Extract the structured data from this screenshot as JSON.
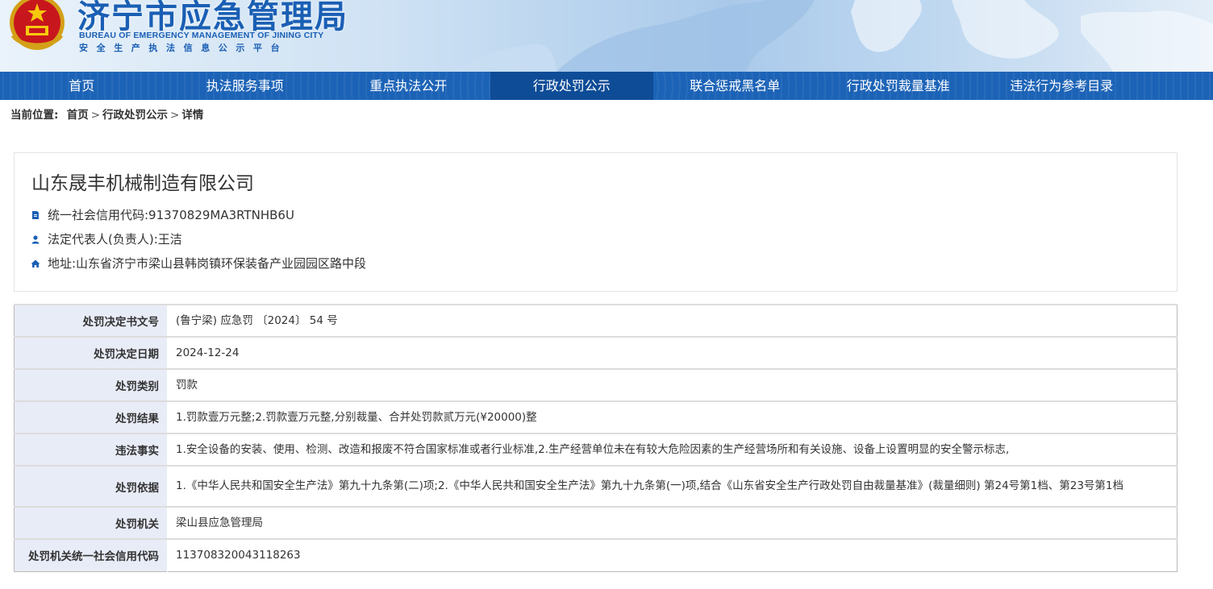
{
  "header": {
    "title": "济宁市应急管理局",
    "subtitle_en": "BUREAU OF EMERGENCY MANAGEMENT OF JINING CITY",
    "subtitle_cn": "安全生产执法信息公示平台",
    "emblem_icon": "national-emblem-icon"
  },
  "nav": {
    "items": [
      {
        "label": "首页"
      },
      {
        "label": "执法服务事项"
      },
      {
        "label": "重点执法公开"
      },
      {
        "label": "行政处罚公示"
      },
      {
        "label": "联合惩戒黑名单"
      },
      {
        "label": "行政处罚裁量基准"
      },
      {
        "label": "违法行为参考目录"
      }
    ],
    "active_index": 3,
    "colors": {
      "bar": "#1c63b7",
      "active": "#0e4c97"
    }
  },
  "breadcrumb": {
    "prefix": "当前位置:",
    "items": [
      "首页",
      "行政处罚公示",
      "详情"
    ],
    "separator": ">"
  },
  "company": {
    "name": "山东晟丰机械制造有限公司",
    "credit_code": "统一社会信用代码:91370829MA3RTNHB6U",
    "legal_rep": "法定代表人(负责人):王洁",
    "address": "地址:山东省济宁市梁山县韩岗镇环保装备产业园园区路中段",
    "icons": [
      "document-icon",
      "person-icon",
      "home-icon"
    ]
  },
  "detail": {
    "rows": [
      {
        "label": "处罚决定书文号",
        "value": "(鲁宁梁) 应急罚 〔2024〕 54 号"
      },
      {
        "label": "处罚决定日期",
        "value": "2024-12-24"
      },
      {
        "label": "处罚类别",
        "value": "罚款"
      },
      {
        "label": "处罚结果",
        "value": "1.罚款壹万元整;2.罚款壹万元整,分别裁量、合并处罚款贰万元(¥20000)整"
      },
      {
        "label": "违法事实",
        "value": "1.安全设备的安装、使用、检测、改造和报废不符合国家标准或者行业标准,2.生产经营单位未在有较大危险因素的生产经营场所和有关设施、设备上设置明显的安全警示标志,"
      },
      {
        "label": "处罚依据",
        "value": "1.《中华人民共和国安全生产法》第九十九条第(二)项;2.《中华人民共和国安全生产法》第九十九条第(一)项,结合《山东省安全生产行政处罚自由裁量基准》(裁量细则) 第24号第1档、第23号第1档"
      },
      {
        "label": "处罚机关",
        "value": "梁山县应急管理局"
      },
      {
        "label": "处罚机关统一社会信用代码",
        "value": "113708320043118263"
      }
    ]
  }
}
